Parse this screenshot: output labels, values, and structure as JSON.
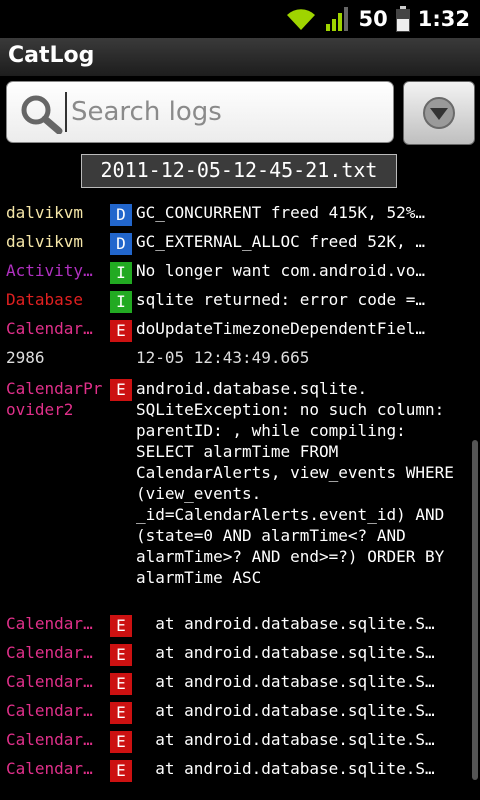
{
  "status": {
    "battery": "50",
    "time": "1:32",
    "icons": [
      "wifi-icon",
      "signal-icon",
      "battery-icon"
    ]
  },
  "app": {
    "title": "CatLog"
  },
  "search": {
    "placeholder": "Search logs",
    "value": ""
  },
  "file": {
    "name": "2011-12-05-12-45-21.txt"
  },
  "colors": {
    "debug_badge": "#2266cc",
    "info_badge": "#22aa22",
    "error_badge": "#cc1111",
    "tag_yellow": "#f5e6a8",
    "tag_purple": "#b030c0",
    "tag_red": "#e02020",
    "tag_pink": "#e0308a"
  },
  "logs": [
    {
      "tag": "dalvikvm",
      "level": "D",
      "message": "GC_CONCURRENT freed 415K, 52%…"
    },
    {
      "tag": "dalvikvm",
      "level": "D",
      "message": "GC_EXTERNAL_ALLOC freed 52K, …"
    },
    {
      "tag": "Activity…",
      "level": "I",
      "message": "No longer want com.android.vo…"
    },
    {
      "tag": "Database",
      "level": "I",
      "message": "sqlite returned: error code =…"
    },
    {
      "tag": "Calendar…",
      "level": "E",
      "message": "doUpdateTimezoneDependentFiel…"
    }
  ],
  "expanded": {
    "pid": "2986",
    "timestamp": "12-05 12:43:49.665",
    "tag": "CalendarProvider2",
    "level": "E",
    "message": "android.database.sqlite. SQLiteException: no such column: parentID: , while compiling: SELECT alarmTime FROM CalendarAlerts, view_events WHERE (view_events. _id=CalendarAlerts.event_id) AND (state=0 AND alarmTime<? AND alarmTime>? AND end>=?) ORDER BY alarmTime ASC"
  },
  "stack": [
    {
      "tag": "Calendar…",
      "level": "E",
      "message": "  at android.database.sqlite.S…"
    },
    {
      "tag": "Calendar…",
      "level": "E",
      "message": "  at android.database.sqlite.S…"
    },
    {
      "tag": "Calendar…",
      "level": "E",
      "message": "  at android.database.sqlite.S…"
    },
    {
      "tag": "Calendar…",
      "level": "E",
      "message": "  at android.database.sqlite.S…"
    },
    {
      "tag": "Calendar…",
      "level": "E",
      "message": "  at android.database.sqlite.S…"
    },
    {
      "tag": "Calendar…",
      "level": "E",
      "message": "  at android.database.sqlite.S…"
    }
  ]
}
